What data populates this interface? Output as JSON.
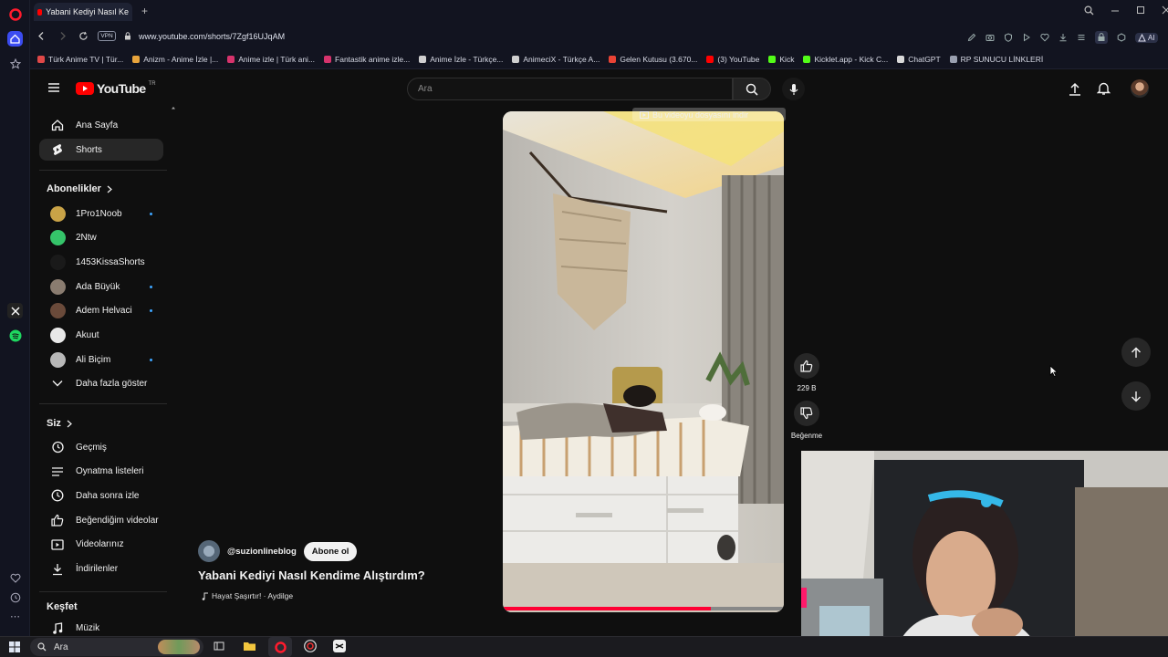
{
  "browser": {
    "tab_title": "Yabani Kediyi Nasıl Ke",
    "url": "www.youtube.com/shorts/7Zgf16UJqAM",
    "vpn_label": "VPN",
    "ai_label": "AI",
    "bookmarks": [
      {
        "label": "Türk Anime TV | Tür...",
        "color": "#e04848"
      },
      {
        "label": "Anizm - Anime İzle |...",
        "color": "#e8a43c"
      },
      {
        "label": "Anime izle | Türk ani...",
        "color": "#d6336c"
      },
      {
        "label": "Fantastik anime izle...",
        "color": "#d6336c"
      },
      {
        "label": "Anime İzle - Türkçe...",
        "color": "#cfcfcf"
      },
      {
        "label": "AnimeciX - Türkçe A...",
        "color": "#cfcfcf"
      },
      {
        "label": "Gelen Kutusu (3.670...",
        "color": "#ea4335"
      },
      {
        "label": "(3) YouTube",
        "color": "#ff0000"
      },
      {
        "label": "Kick",
        "color": "#53fc18"
      },
      {
        "label": "Kicklet.app - Kick C...",
        "color": "#53fc18"
      },
      {
        "label": "ChatGPT",
        "color": "#d9d9d9"
      },
      {
        "label": "RP SUNUCU LİNKLERİ",
        "color": "#9aa0b0"
      }
    ]
  },
  "youtube": {
    "logo_text": "YouTube",
    "logo_region": "TR",
    "search_placeholder": "Ara",
    "sidebar": {
      "home": "Ana Sayfa",
      "shorts": "Shorts",
      "subs_header": "Abonelikler",
      "subscriptions": [
        {
          "name": "1Pro1Noob",
          "color": "#c9a347",
          "dot": true
        },
        {
          "name": "2Ntw",
          "color": "#35c46a",
          "dot": false
        },
        {
          "name": "1453KissaShorts",
          "color": "#1a1a1a",
          "dot": false
        },
        {
          "name": "Ada Büyük",
          "color": "#8a7c70",
          "dot": true
        },
        {
          "name": "Adem Helvaci",
          "color": "#6a4a3a",
          "dot": true
        },
        {
          "name": "Akuut",
          "color": "#e8e8e8",
          "dot": false
        },
        {
          "name": "Ali Biçim",
          "color": "#b8b8b8",
          "dot": true
        }
      ],
      "show_more": "Daha fazla göster",
      "you_header": "Siz",
      "you_items": [
        {
          "label": "Geçmiş",
          "icon": "history-icon"
        },
        {
          "label": "Oynatma listeleri",
          "icon": "playlist-icon"
        },
        {
          "label": "Daha sonra izle",
          "icon": "clock-icon"
        },
        {
          "label": "Beğendiğim videolar",
          "icon": "thumbs-up-icon"
        },
        {
          "label": "Videolarınız",
          "icon": "video-icon"
        },
        {
          "label": "İndirilenler",
          "icon": "download-icon"
        }
      ],
      "explore_header": "Keşfet",
      "explore_first": "Müzik"
    },
    "short": {
      "download_banner": "Bu videoyu dosyasını indir",
      "channel": "@suzionlineblog",
      "subscribe": "Abone ol",
      "title": "Yabani Kediyi Nasıl Kendime Alıştırdım?",
      "music": "Hayat Şaşırtır! · Aydilge",
      "likes": "229 B",
      "dislike_label": "Beğenme"
    }
  },
  "taskbar": {
    "search_placeholder": "Ara"
  }
}
